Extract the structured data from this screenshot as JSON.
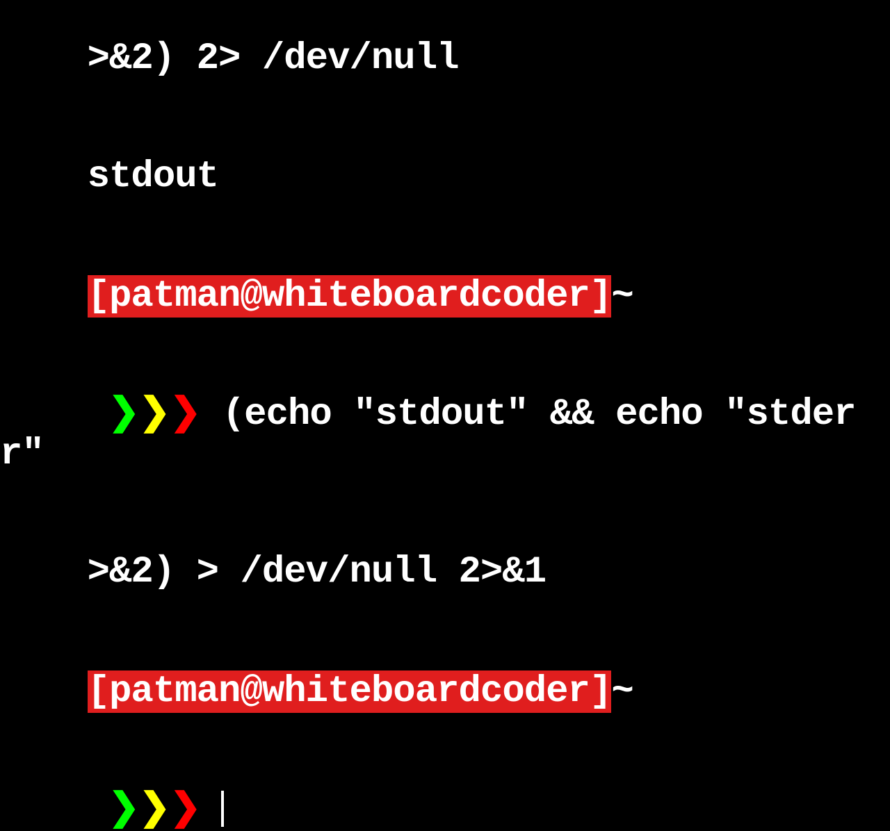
{
  "partial_top_line": ">&2) 2> /dev/null",
  "output1": "stdout",
  "prompt": {
    "user_host": "[patman@whiteboardcoder]",
    "path": "~"
  },
  "chevrons": {
    "c1": "❯",
    "c2": "❯",
    "c3": "❯"
  },
  "command1_line1": " (echo \"stdout\" && echo \"stderr\"",
  "command1_line2": ">&2) > /dev/null 2>&1"
}
